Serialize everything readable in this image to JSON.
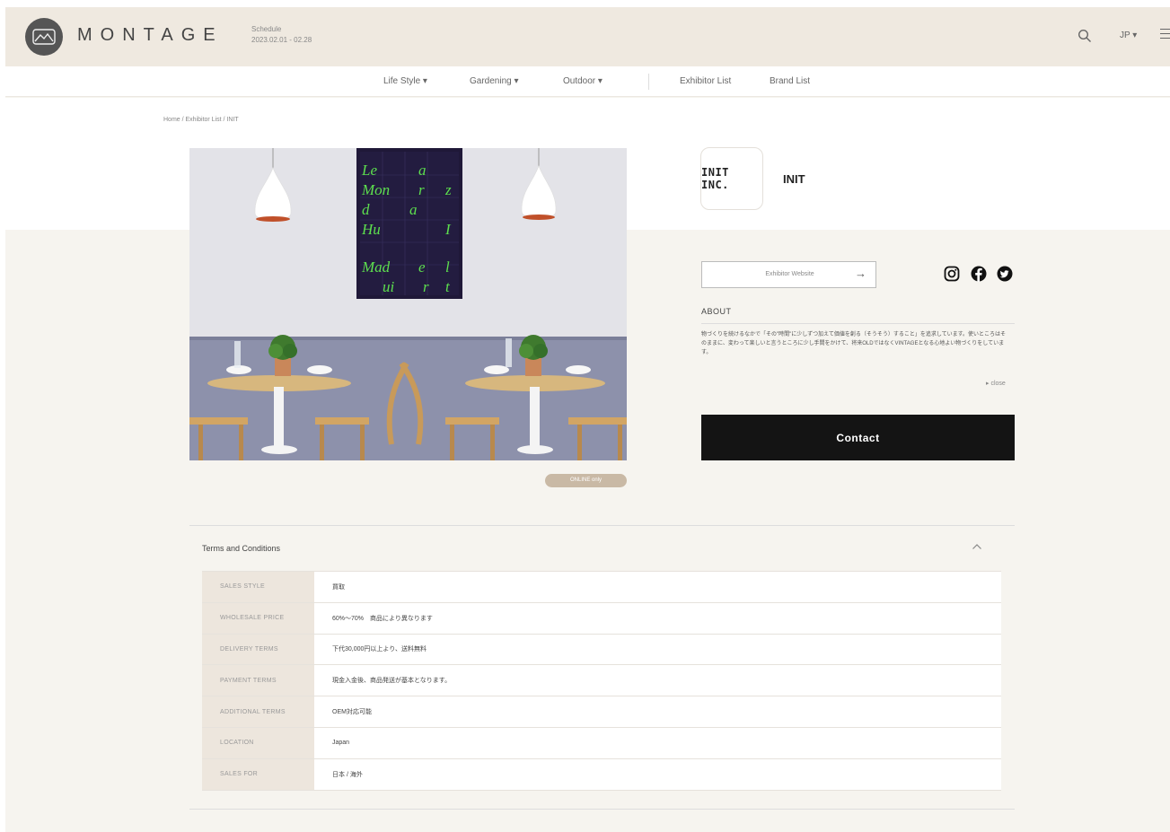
{
  "header": {
    "brand": "MONTAGE",
    "schedule_label": "Schedule",
    "schedule_dates": "2023.02.01 - 02.28",
    "lang": "JP ▾"
  },
  "nav": {
    "items": [
      {
        "label": "Life Style ▾"
      },
      {
        "label": "Gardening ▾"
      },
      {
        "label": "Outdoor ▾"
      },
      {
        "label": "Exhibitor List"
      },
      {
        "label": "Brand List"
      }
    ]
  },
  "breadcrumb": "Home / Exhibitor List / INIT",
  "online_badge": "ONLINE only",
  "exhibitor": {
    "logo_text": "INIT INC.",
    "name": "INIT",
    "website_label": "Exhibitor Website",
    "website_arrow": "→",
    "about_heading": "ABOUT",
    "about_text": "物づくりを続けるなかで「その\"時間\"に少しずつ加えて価値を創る（そうそう）すること」を追求しています。使いところはそのままに、変わって楽しいと言うところに少し手間をかけて、将来OLDではなくVINTAGEとなる心地よい物づくりをしています。",
    "close_label": "▸ close",
    "contact_label": "Contact"
  },
  "terms": {
    "title": "Terms and Conditions",
    "rows": [
      {
        "key": "SALES STYLE",
        "value": "買取"
      },
      {
        "key": "WHOLESALE PRICE",
        "value": "60%〜70%　商品により異なります"
      },
      {
        "key": "DELIVERY TERMS",
        "value": "下代30,000円以上より、送料無料"
      },
      {
        "key": "PAYMENT TERMS",
        "value": "現金入金後、商品発送が基本となります。"
      },
      {
        "key": "ADDITIONAL TERMS",
        "value": "OEM対応可能"
      },
      {
        "key": "LOCATION",
        "value": "Japan"
      },
      {
        "key": "SALES FOR",
        "value": "日本 / 海外"
      }
    ]
  }
}
